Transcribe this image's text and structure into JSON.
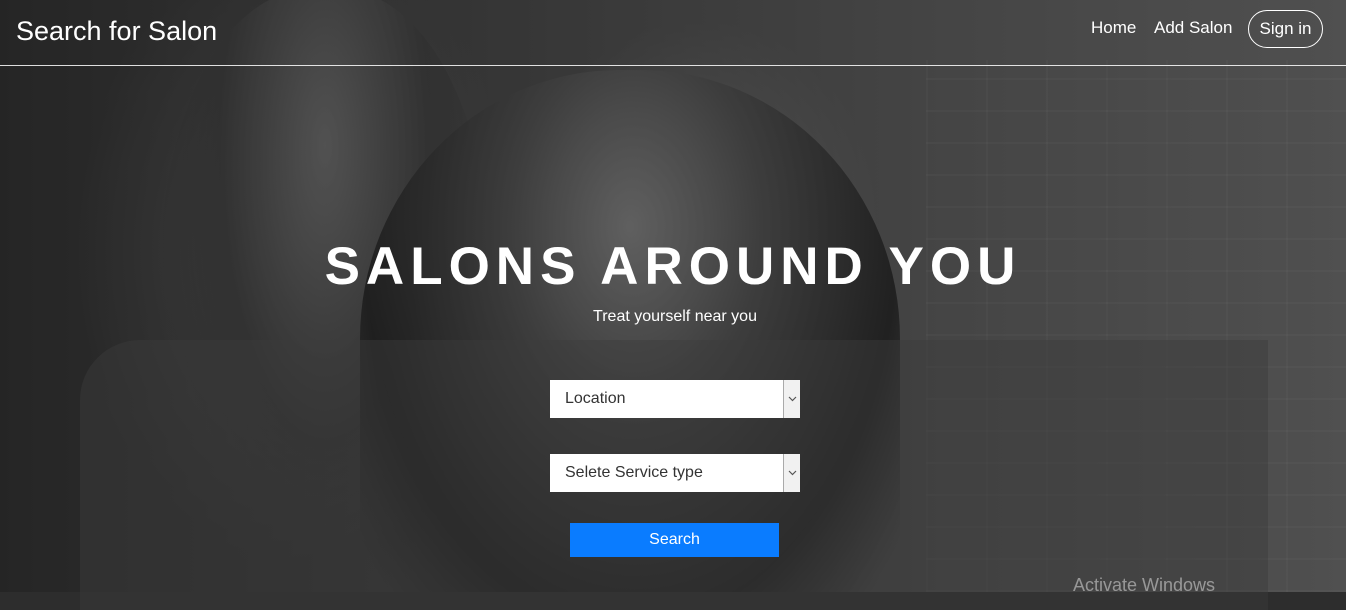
{
  "navbar": {
    "brand": "Search for Salon",
    "links": [
      "Home",
      "Add Salon"
    ],
    "signin_label": "Sign in"
  },
  "hero": {
    "title": "SALONS AROUND YOU",
    "subtitle": "Treat yourself near you"
  },
  "search_form": {
    "location_select": "Location",
    "service_select": "Selete Service type",
    "search_label": "Search"
  },
  "watermark": "Activate Windows",
  "colors": {
    "accent": "#0a7cff",
    "text": "#ffffff"
  },
  "icons": [
    "chevron-down-icon"
  ]
}
